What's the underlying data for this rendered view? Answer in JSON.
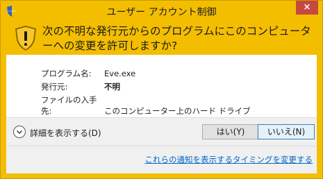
{
  "window": {
    "title": "ユーザー アカウント制御",
    "close_label": "×"
  },
  "header": {
    "question": "次の不明な発行元からのプログラムにこのコンピューターへの変更を許可しますか?"
  },
  "details": {
    "program_name_label": "プログラム名:",
    "program_name_value": "Eve.exe",
    "publisher_label": "発行元:",
    "publisher_value": "不明",
    "file_origin_label": "ファイルの入手先:",
    "file_origin_value": "このコンピューター上のハード ドライブ"
  },
  "footer": {
    "show_details_label": "詳細を表示する(D)",
    "yes_label": "はい(Y)",
    "no_label": "いいえ(N)",
    "change_notification_link": "これらの通知を表示するタイミングを変更する"
  },
  "colors": {
    "accent": "#f4be00",
    "link": "#0066cc",
    "close": "#c7483d"
  },
  "icons": [
    "uac-shield-icon",
    "warning-shield-icon",
    "chevron-down-icon"
  ]
}
